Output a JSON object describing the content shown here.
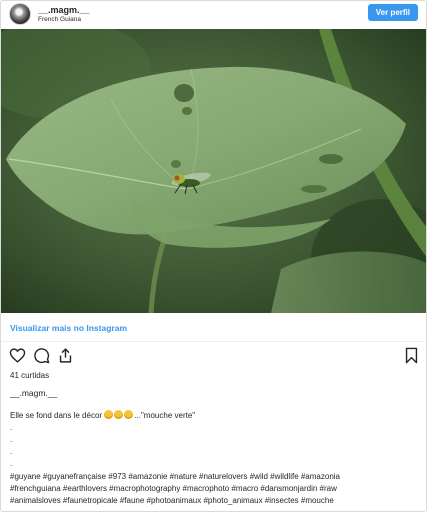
{
  "post": {
    "username": "__.magm.__",
    "location": "French Guiana",
    "view_profile_label": "Ver perfil",
    "view_more_label": "Visualizar mais no Instagram",
    "likes_text": "41 curtidas",
    "owner": "__.magm.__",
    "caption_text": "Elle se fond dans le décor",
    "caption_quote": "...\"mouche verte\"",
    "emoji_count": 3,
    "dots": [
      ".",
      ".",
      ".",
      "."
    ],
    "hashtags_line1": "#guyane #guyanefrançaise #973 #amazonie #nature #naturelovers #wild #wildlife #amazonia",
    "hashtags_line2": "#frenchguiana #earthlovers #macrophotography #macrophoto #macro #dansmonjardin #raw",
    "hashtags_line3": "#animalsloves #faunetropicale #faune #photoanimaux #photo_animaux #insectes #mouche"
  },
  "icons": {
    "like": "heart-icon",
    "comment": "comment-icon",
    "share": "share-icon",
    "save": "bookmark-icon",
    "avatar": "profile-avatar"
  },
  "colors": {
    "accent": "#3897f0",
    "text": "#262626",
    "border": "#dbdbdb"
  }
}
